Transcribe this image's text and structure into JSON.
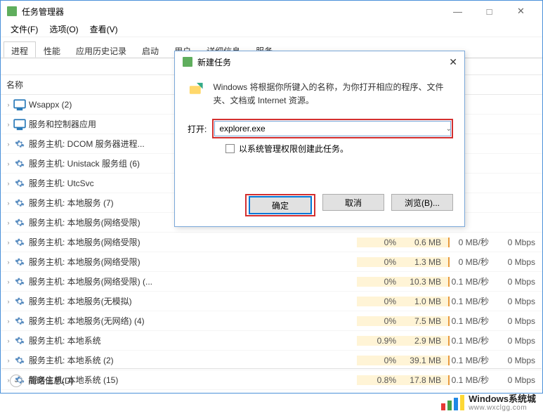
{
  "window": {
    "title": "任务管理器",
    "minimize": "—",
    "maximize": "□",
    "close": "✕"
  },
  "menu": {
    "file": "文件(F)",
    "options": "选项(O)",
    "view": "查看(V)"
  },
  "tabs_list": {
    "processes": "进程",
    "performance": "性能",
    "history": "应用历史记录",
    "startup": "启动",
    "users": "用户",
    "details": "详细信息",
    "services": "服务"
  },
  "columns": {
    "name": "名称"
  },
  "rows": [
    {
      "label": "Wsappx (2)",
      "icon": "monitor",
      "cpu": "",
      "mem": "",
      "disk": "",
      "net": ""
    },
    {
      "label": "服务和控制器应用",
      "icon": "monitor",
      "cpu": "",
      "mem": "",
      "disk": "",
      "net": ""
    },
    {
      "label": "服务主机: DCOM 服务器进程...",
      "icon": "gear",
      "cpu": "",
      "mem": "",
      "disk": "",
      "net": ""
    },
    {
      "label": "服务主机: Unistack 服务组 (6)",
      "icon": "gear",
      "cpu": "",
      "mem": "",
      "disk": "",
      "net": ""
    },
    {
      "label": "服务主机: UtcSvc",
      "icon": "gear",
      "cpu": "",
      "mem": "",
      "disk": "",
      "net": ""
    },
    {
      "label": "服务主机: 本地服务 (7)",
      "icon": "gear",
      "cpu": "",
      "mem": "",
      "disk": "",
      "net": ""
    },
    {
      "label": "服务主机: 本地服务(网络受限)",
      "icon": "gear",
      "cpu": "",
      "mem": "",
      "disk": "",
      "net": ""
    },
    {
      "label": "服务主机: 本地服务(网络受限)",
      "icon": "gear",
      "cpu": "0%",
      "mem": "0.6 MB",
      "disk": "0 MB/秒",
      "net": "0 Mbps"
    },
    {
      "label": "服务主机: 本地服务(网络受限)",
      "icon": "gear",
      "cpu": "0%",
      "mem": "1.3 MB",
      "disk": "0 MB/秒",
      "net": "0 Mbps"
    },
    {
      "label": "服务主机: 本地服务(网络受限) (...",
      "icon": "gear",
      "cpu": "0%",
      "mem": "10.3 MB",
      "disk": "0.1 MB/秒",
      "net": "0 Mbps"
    },
    {
      "label": "服务主机: 本地服务(无模拟)",
      "icon": "gear",
      "cpu": "0%",
      "mem": "1.0 MB",
      "disk": "0.1 MB/秒",
      "net": "0 Mbps"
    },
    {
      "label": "服务主机: 本地服务(无网络) (4)",
      "icon": "gear",
      "cpu": "0%",
      "mem": "7.5 MB",
      "disk": "0.1 MB/秒",
      "net": "0 Mbps"
    },
    {
      "label": "服务主机: 本地系统",
      "icon": "gear",
      "cpu": "0.9%",
      "mem": "2.9 MB",
      "disk": "0.1 MB/秒",
      "net": "0 Mbps"
    },
    {
      "label": "服务主机: 本地系统 (2)",
      "icon": "gear",
      "cpu": "0%",
      "mem": "39.1 MB",
      "disk": "0.1 MB/秒",
      "net": "0 Mbps"
    },
    {
      "label": "服务主机: 本地系统 (15)",
      "icon": "gear",
      "cpu": "0.8%",
      "mem": "17.8 MB",
      "disk": "0.1 MB/秒",
      "net": "0 Mbps"
    }
  ],
  "simple": {
    "label": "简略信息(D)"
  },
  "dialog": {
    "title": "新建任务",
    "close": "✕",
    "message": "Windows 将根据你所键入的名称，为你打开相应的程序、文件夹、文档或 Internet 资源。",
    "open_label": "打开:",
    "input_value": "explorer.exe",
    "checkbox_label": "以系统管理权限创建此任务。",
    "ok": "确定",
    "cancel": "取消",
    "browse": "浏览(B)..."
  },
  "watermark": {
    "line1": "Windows系统城",
    "line2": "www.wxclgg.com"
  }
}
